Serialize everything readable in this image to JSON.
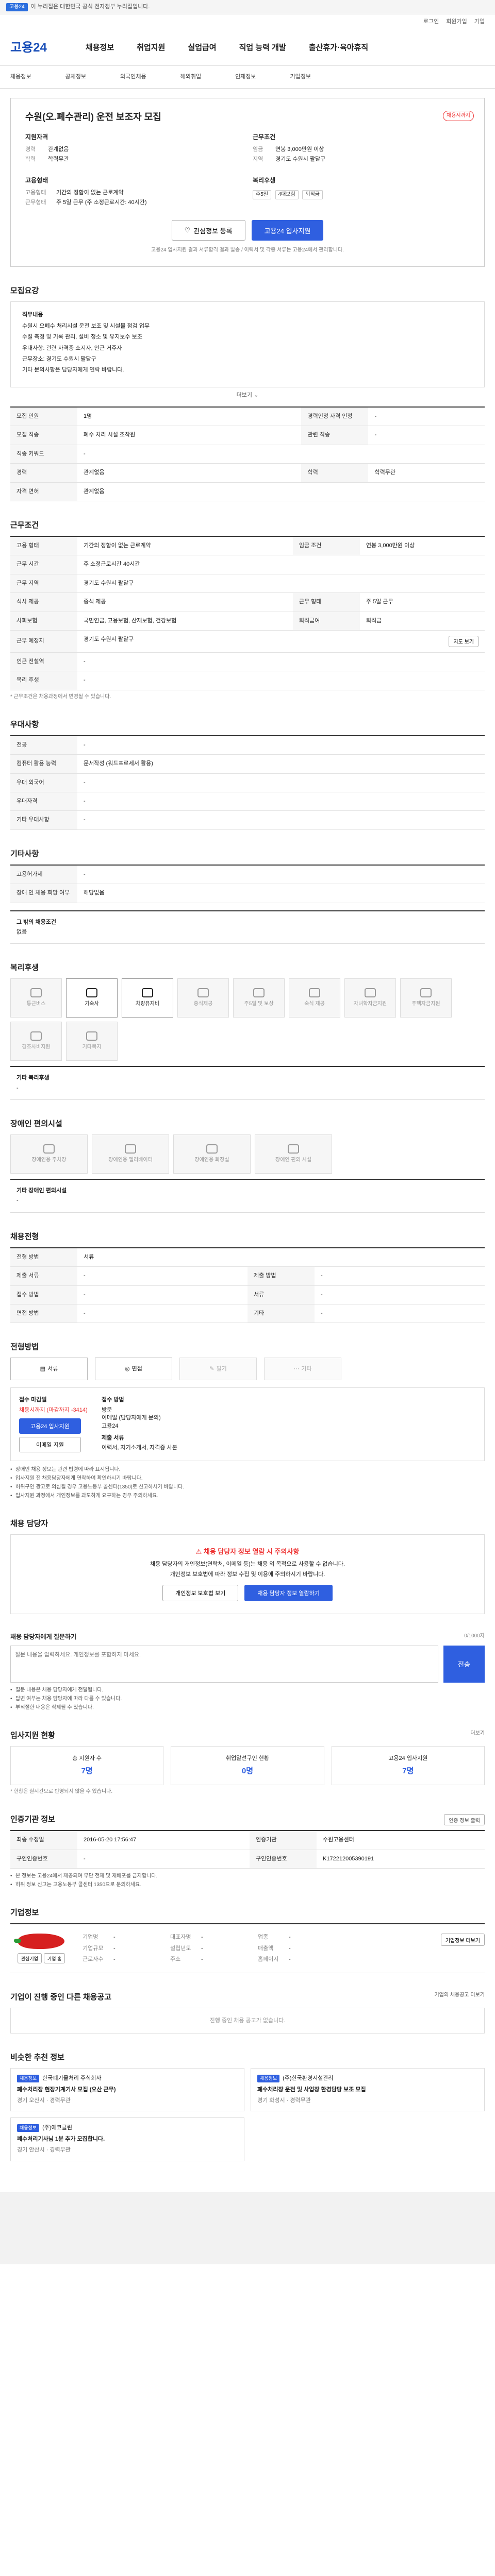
{
  "topbar": {
    "tag": "고용24",
    "text": "이 누리집은 대한민국 공식 전자정부 누리집입니다."
  },
  "util": [
    "로그인",
    "회원가입",
    "기업"
  ],
  "header": {
    "logo": "고용24",
    "gnb": [
      "채용정보",
      "취업지원",
      "실업급여",
      "직업 능력 개발",
      "출산휴가·육아휴직"
    ]
  },
  "subnav": [
    "채용정보",
    "공채정보",
    "외국인채용",
    "해외취업",
    "인재정보",
    "기업정보"
  ],
  "job": {
    "title": "수원(오.폐수관리) 운전 보조자 모집",
    "badge": "채용시까지",
    "summary_left_title": "지원자격",
    "summary_left": [
      {
        "k": "경력",
        "v": "관계없음"
      },
      {
        "k": "학력",
        "v": "학력무관"
      }
    ],
    "summary_right_title": "근무조건",
    "summary_right": [
      {
        "k": "임금",
        "v": "연봉 3,000만원 이상"
      },
      {
        "k": "지역",
        "v": "경기도 수원시 팔달구"
      }
    ],
    "work_title": "고용형태",
    "work": [
      {
        "k": "고용형태",
        "v": "기간의 정함이 없는 근로계약"
      },
      {
        "k": "근무형태",
        "v": "주 5일 근무 (주 소정근로시간: 40시간)"
      }
    ],
    "benefit_title": "복리후생",
    "benefits": [
      "주5일",
      "4대보험",
      "퇴직금"
    ],
    "btn_scrap": "관심정보 등록",
    "btn_apply": "고용24 입사지원",
    "note": "고용24 입사지원 결과 서류합격 결과 발송 / 이력서 및 각종 서류는 고용24에서 관리합니다."
  },
  "detail": {
    "title": "모집요강",
    "headline": "직무내용",
    "lines": [
      "수원시 오폐수 처리시설 운전 보조 및 시설물 점검 업무",
      "수질 측정 및 기록 관리, 설비 청소 및 유지보수 보조",
      "우대사항: 관련 자격증 소지자, 인근 거주자",
      "근무장소: 경기도 수원시 팔달구",
      "기타 문의사항은 담당자에게 연락 바랍니다."
    ],
    "fold": "더보기",
    "rows": [
      [
        {
          "k": "모집 인원",
          "v": "1명"
        },
        {
          "k": "경력인정 자격 인정",
          "v": "-"
        }
      ],
      [
        {
          "k": "모집 직종",
          "v": "폐수 처리 시설 조작원"
        },
        {
          "k": "관련 직종",
          "v": "-"
        }
      ],
      [
        {
          "k": "직종 키워드",
          "v": "-"
        },
        {
          "k": "",
          "v": ""
        }
      ],
      [
        {
          "k": "경력",
          "v": "관계없음"
        },
        {
          "k": "학력",
          "v": "학력무관"
        }
      ],
      [
        {
          "k": "자격 면허",
          "v": "관계없음"
        },
        {
          "k": "",
          "v": ""
        }
      ]
    ]
  },
  "conditions": {
    "title": "근무조건",
    "rows": [
      {
        "k": "고용 형태",
        "v": "기간의 정함이 없는 근로계약",
        "k2": "임금 조건",
        "v2": "연봉 3,000만원 이상"
      },
      {
        "k": "근무 시간",
        "v": "주 소정근로시간 40시간",
        "k2": "",
        "v2": ""
      },
      {
        "k": "근무 지역",
        "v": "경기도 수원시 팔달구",
        "k2": "",
        "v2": ""
      },
      {
        "k": "식사 제공",
        "v": "중식 제공",
        "k2": "근무 형태",
        "v2": "주 5일 근무"
      },
      {
        "k": "사회보험",
        "v": "국민연금, 고용보험, 산재보험, 건강보험",
        "k2": "퇴직급여",
        "v2": "퇴직금"
      },
      {
        "k": "근무 예정지",
        "v": "경기도 수원시 팔달구",
        "k2": "",
        "v2": ""
      },
      {
        "k": "인근 전철역",
        "v": "-",
        "k2": "",
        "v2": ""
      },
      {
        "k": "복리 후생",
        "v": "-",
        "k2": "",
        "v2": ""
      }
    ],
    "map_btn": "지도 보기",
    "footnote": "* 근무조건은 채용과정에서 변경될 수 있습니다."
  },
  "priority": {
    "title": "우대사항",
    "rows": [
      {
        "k": "전공",
        "v": "-"
      },
      {
        "k": "컴퓨터 활용 능력",
        "v": "문서작성 (워드프로세서 활용)"
      },
      {
        "k": "우대 외국어",
        "v": "-"
      },
      {
        "k": "우대자격",
        "v": "-"
      },
      {
        "k": "기타 우대사항",
        "v": "-"
      }
    ]
  },
  "disability": {
    "title": "기타사항",
    "rows": [
      {
        "k": "고용허가제",
        "v": "-"
      },
      {
        "k": "장애 인 채용 희망 여부",
        "v": "해당없음"
      }
    ],
    "extra": "그 밖의 채용조건",
    "extra_v": "없음"
  },
  "welfare": {
    "title": "복리후생",
    "cards": [
      {
        "label": "통근버스",
        "on": false
      },
      {
        "label": "기숙사",
        "on": true
      },
      {
        "label": "차량유지비",
        "on": true
      },
      {
        "label": "중식제공",
        "on": false
      },
      {
        "label": "주5일 및 보상",
        "on": false
      },
      {
        "label": "숙식 제공",
        "on": false
      },
      {
        "label": "자녀학자금지원",
        "on": false
      },
      {
        "label": "주택자금지원",
        "on": false
      },
      {
        "label": "경조사비지원",
        "on": false
      },
      {
        "label": "기타복지",
        "on": false
      }
    ],
    "other_title": "기타 복리후생",
    "other": "-"
  },
  "access": {
    "title": "장애인 편의시설",
    "cards": [
      "장애인용 주차장",
      "장애인용 엘리베이터",
      "장애인용 화장실",
      "장애인 편의 시설"
    ],
    "other_title": "기타 장애인 편의시설",
    "other": "-"
  },
  "process": {
    "title": "채용전형",
    "rows": [
      {
        "k": "전형 방법",
        "v": "서류"
      },
      {
        "k": "제출 서류",
        "v": "-",
        "k2": "제출 방법",
        "v2": "-"
      },
      {
        "k": "접수 방법",
        "v": "-",
        "k2": "서류",
        "v2": "-"
      },
      {
        "k": "면접 방법",
        "v": "-",
        "k2": "기타",
        "v2": "-"
      }
    ]
  },
  "steps": {
    "title": "전형방법",
    "items": [
      {
        "label": "서류",
        "on": true
      },
      {
        "label": "면접",
        "on": true
      },
      {
        "label": "필기",
        "on": false
      },
      {
        "label": "기타",
        "on": false
      }
    ]
  },
  "apply": {
    "left_title": "접수 마감일",
    "deadline": "채용시까지 (마감까지 -3414)",
    "btn": "고용24 입사지원",
    "btn2": "이메일 지원",
    "right_title": "접수 방법",
    "methods": [
      "방문",
      "이메일 (담당자에게 문의)",
      "고용24"
    ],
    "docs_title": "제출 서류",
    "docs": "이력서, 자기소개서, 자격증 사본",
    "bullets": [
      "장애인 채용 정보는 관련 법령에 따라 표시됩니다.",
      "입사지원 전 채용담당자에게 연락하여 확인하시기 바랍니다.",
      "허위구인 광고로 의심될 경우 고용노동부 콜센터(1350)로 신고하시기 바랍니다.",
      "입사지원 과정에서 개인정보를 과도하게 요구하는 경우 주의하세요."
    ]
  },
  "manager": {
    "title": "채용 담당자",
    "warn": "채용 담당자 정보 열람 시 주의사항",
    "lines": [
      "채용 담당자의 개인정보(연락처, 이메일 등)는 채용 외 목적으로 사용할 수 없습니다.",
      "개인정보 보호법에 따라 정보 수집 및 이용에 주의하시기 바랍니다."
    ],
    "btn1": "개인정보 보호법 보기",
    "btn2": "채용 담당자 정보 열람하기"
  },
  "qna": {
    "title": "채용 담당자에게 질문하기",
    "right": "0/1000자",
    "placeholder": "질문 내용을 입력하세요. 개인정보를 포함하지 마세요.",
    "send": "전송",
    "bullets": [
      "질문 내용은 채용 담당자에게 전달됩니다.",
      "답변 여부는 채용 담당자에 따라 다를 수 있습니다.",
      "부적절한 내용은 삭제될 수 있습니다."
    ]
  },
  "stats": {
    "title": "입사지원 현황",
    "more": "더보기",
    "items": [
      {
        "label": "총 지원자 수",
        "num": "7명"
      },
      {
        "label": "취업알선구인 현황",
        "num": "0명"
      },
      {
        "label": "고용24 입사지원",
        "num": "7명"
      }
    ],
    "note": "* 현황은 실시간으로 반영되지 않을 수 있습니다."
  },
  "posting": {
    "title": "인증기관 정보",
    "btn": "인증 정보 출력",
    "rows": [
      {
        "k": "최종 수정일",
        "v": "2016-05-20 17:56:47",
        "k2": "인증기관",
        "v2": "수원고용센터"
      },
      {
        "k": "구인인증번호",
        "v": "-",
        "k2": "구인인증번호",
        "v2": "K172212005390191"
      }
    ],
    "lines": [
      "본 정보는 고용24에서 제공되며 무단 전재 및 재배포를 금지합니다.",
      "허위 정보 신고는 고용노동부 콜센터 1350으로 문의하세요."
    ]
  },
  "company": {
    "title": "기업정보",
    "btn": "기업정보 더보기",
    "logo_btns": [
      "관심기업",
      "기업 홈"
    ],
    "grid": [
      {
        "k": "기업명",
        "v": "-"
      },
      {
        "k": "대표자명",
        "v": "-"
      },
      {
        "k": "업종",
        "v": "-"
      },
      {
        "k": "기업규모",
        "v": "-"
      },
      {
        "k": "설립년도",
        "v": "-"
      },
      {
        "k": "매출액",
        "v": "-"
      },
      {
        "k": "근로자수",
        "v": "-"
      },
      {
        "k": "주소",
        "v": "-"
      },
      {
        "k": "홈페이지",
        "v": "-"
      }
    ]
  },
  "others": {
    "title": "기업이 진행 중인 다른 채용공고",
    "right": "기업의 채용공고 더보기",
    "empty": "진행 중인 채용 공고가 없습니다."
  },
  "reco": {
    "title": "비슷한 추천 정보",
    "cards": [
      {
        "tag": "채용정보",
        "company": "한국폐기물처리 주식회사",
        "title": "폐수처리장 현장기계기사 모집 (오산 근무)",
        "meta": "경기 오산시 · 경력무관"
      },
      {
        "tag": "채용정보",
        "company": "(주)한국환경시설관리",
        "title": "폐수처리장 운전 및 사업장 환경담당 보조 모집",
        "meta": "경기 화성시 · 경력무관"
      },
      {
        "tag": "채용정보",
        "company": "(주)에코클린",
        "title": "폐수처리기사님 1분 추가 모집합니다.",
        "meta": "경기 안산시 · 경력무관"
      }
    ]
  }
}
